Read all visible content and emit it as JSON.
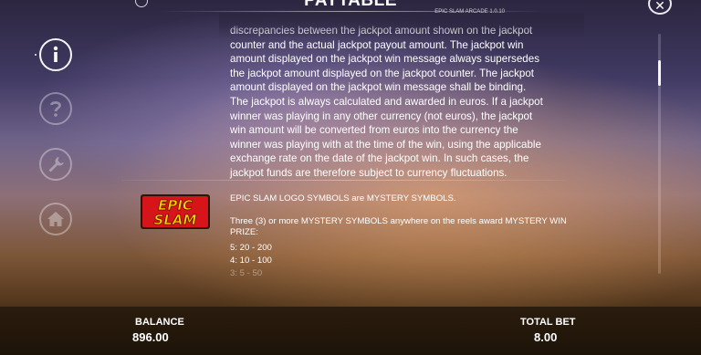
{
  "header": {
    "title": "PAYTABLE",
    "version": "EPIC SLAM ARCADE 1.0.10"
  },
  "sidebar": {
    "items": [
      {
        "name": "info",
        "icon": "info-icon",
        "active": true
      },
      {
        "name": "help",
        "icon": "question-icon",
        "active": false
      },
      {
        "name": "settings",
        "icon": "wrench-icon",
        "active": false
      },
      {
        "name": "home",
        "icon": "home-icon",
        "active": false
      }
    ]
  },
  "jackpot_text": [
    "discrepancies between the jackpot amount shown on the jackpot",
    "counter and the actual jackpot payout amount. The jackpot win",
    "amount displayed on the jackpot win message always supersedes",
    "the jackpot amount displayed on the jackpot counter. The jackpot",
    "amount displayed on the jackpot win message shall be binding.",
    "The jackpot is always calculated and awarded in euros. If a jackpot",
    "winner was playing in any other currency (not euros), the jackpot",
    "win amount will be converted from euros into the currency the",
    "winner was playing with at the time of the win, using the applicable",
    "exchange rate on the date of the jackpot win. In such cases, the",
    "jackpot funds are therefore subject to currency fluctuations."
  ],
  "mystery": {
    "logo_text": "EPIC SLAM",
    "title": "EPIC SLAM LOGO SYMBOLS are MYSTERY SYMBOLS.",
    "desc_line1": "Three (3) or more MYSTERY SYMBOLS anywhere on the reels award  MYSTERY WIN",
    "desc_line2": "PRIZE:",
    "pay1": "5: 20 - 200",
    "pay2": "4: 10 - 100",
    "pay3": "3: 5 - 50"
  },
  "footer": {
    "balance_label": "BALANCE",
    "balance_value": "896.00",
    "bet_label": "TOTAL BET",
    "bet_value": "8.00"
  },
  "colors": {
    "logo_yellow": "#ffd400",
    "logo_red": "#d8141b",
    "bottom_bar": "#24180b"
  }
}
